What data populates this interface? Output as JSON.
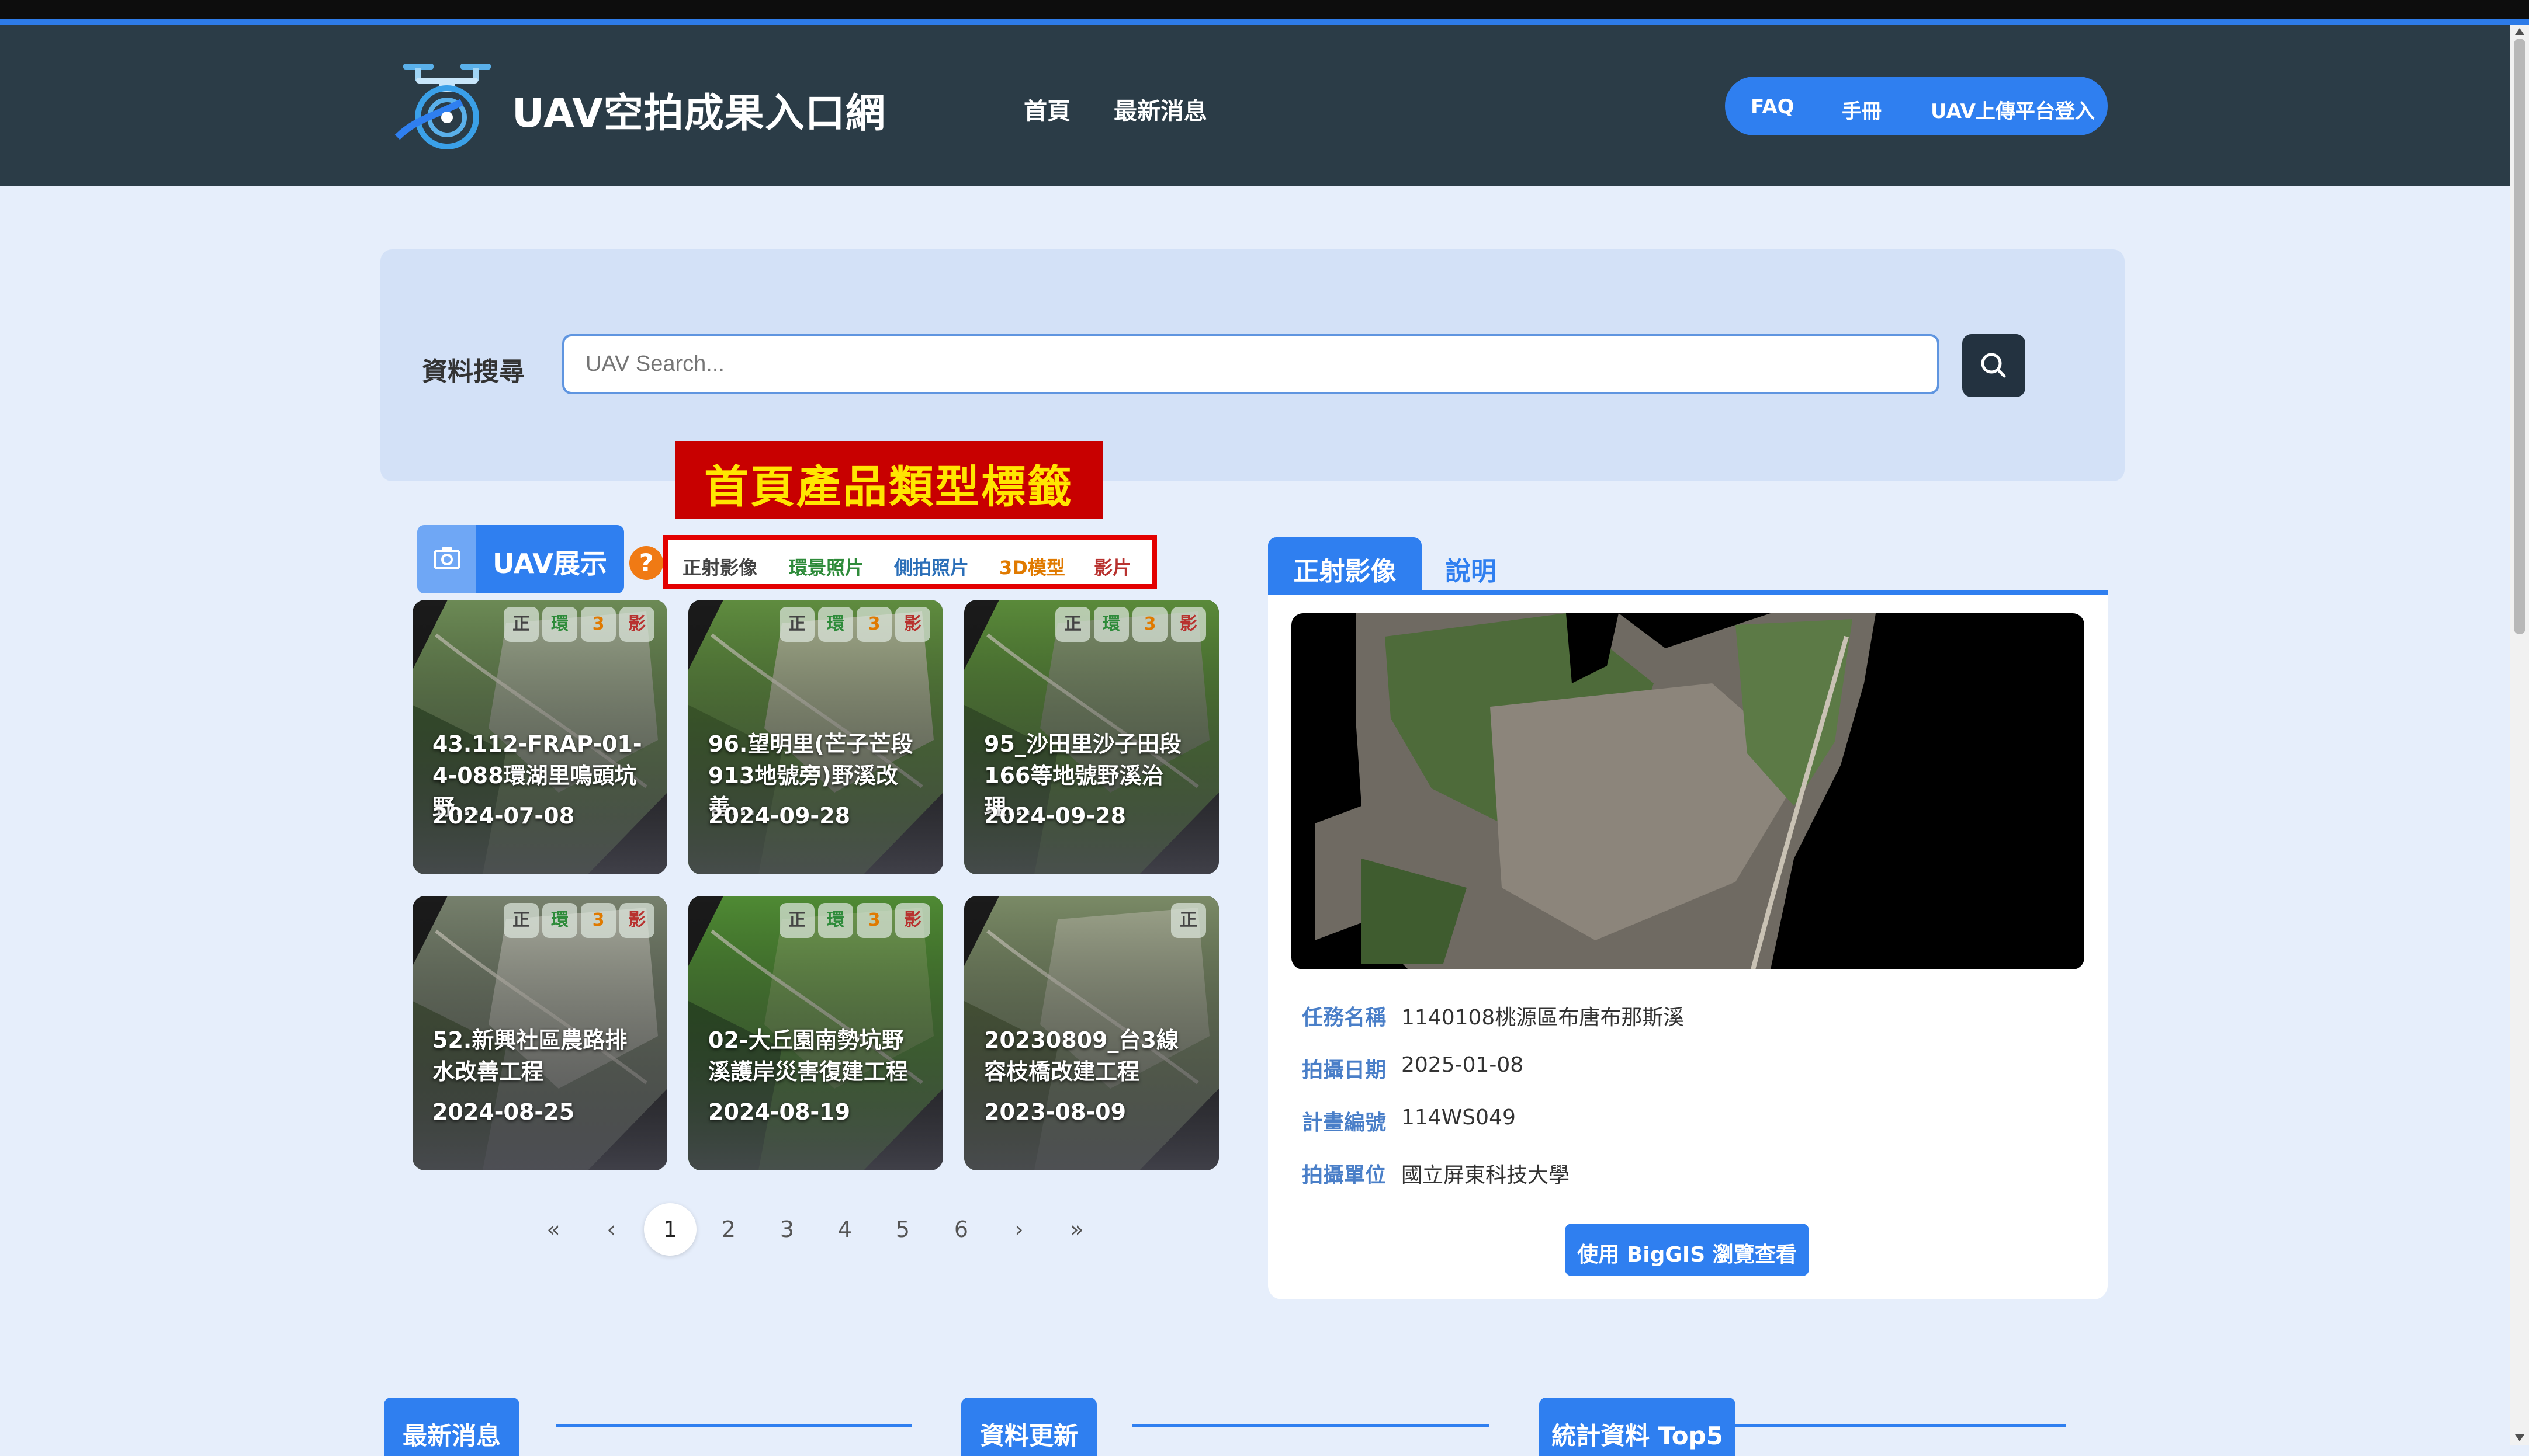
{
  "header": {
    "brand": "UAV空拍成果入口網",
    "nav": [
      "首頁",
      "最新消息"
    ],
    "actions": [
      "FAQ",
      "手冊",
      "UAV上傳平台登入"
    ]
  },
  "search": {
    "label": "資料搜尋",
    "placeholder": "UAV Search..."
  },
  "annotation": {
    "title": "首頁產品類型標籤"
  },
  "tags": [
    {
      "label": "正射影像",
      "color": "#444444"
    },
    {
      "label": "環景照片",
      "color": "#2e8b3a"
    },
    {
      "label": "側拍照片",
      "color": "#2b6fb8"
    },
    {
      "label": "3D模型",
      "color": "#e07a00"
    },
    {
      "label": "影片",
      "color": "#b8322f"
    }
  ],
  "showcase": {
    "label": "UAV展示",
    "help": "?"
  },
  "chip_labels": {
    "ortho": "正",
    "pano": "環",
    "model": "3",
    "video": "影"
  },
  "cards": [
    {
      "title": "43.112-FRAP-01-4-088環湖里嗚頭坑野...",
      "date": "2024-07-08"
    },
    {
      "title": "96.望明里(芒子芒段913地號旁)野溪改善...",
      "date": "2024-09-28"
    },
    {
      "title": "95_沙田里沙子田段166等地號野溪治理...",
      "date": "2024-09-28"
    },
    {
      "title": "52.新興社區農路排水改善工程",
      "date": "2024-08-25"
    },
    {
      "title": "02-大丘園南勢坑野溪護岸災害復建工程",
      "date": "2024-08-19"
    },
    {
      "title": "20230809_台3線容枝橋改建工程",
      "date": "2023-08-09"
    }
  ],
  "pagination": {
    "first": "«",
    "prev": "‹",
    "pages": [
      "1",
      "2",
      "3",
      "4",
      "5",
      "6"
    ],
    "next": "›",
    "last": "»",
    "current": "1"
  },
  "detail": {
    "tabs": [
      "正射影像",
      "說明"
    ],
    "fields": [
      {
        "label": "任務名稱",
        "value": "1140108桃源區布唐布那斯溪"
      },
      {
        "label": "拍攝日期",
        "value": "2025-01-08"
      },
      {
        "label": "計畫編號",
        "value": "114WS049"
      },
      {
        "label": "拍攝單位",
        "value": "國立屏東科技大學"
      }
    ],
    "button": "使用 BigGIS 瀏覽查看"
  },
  "sections": [
    "最新消息",
    "資料更新",
    "統計資料 Top5"
  ],
  "colors": {
    "accent": "#2f7ff0",
    "header": "#2b3c47",
    "background": "#e6eefb"
  }
}
